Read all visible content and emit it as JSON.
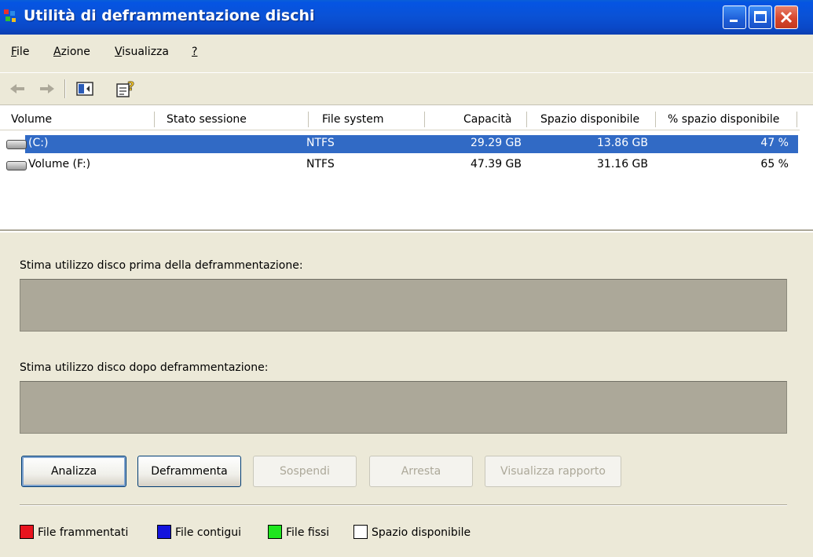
{
  "window": {
    "title": "Utilità di deframmentazione dischi"
  },
  "menu": [
    {
      "accel": "F",
      "rest": "ile"
    },
    {
      "accel": "A",
      "rest": "zione"
    },
    {
      "accel": "V",
      "rest": "isualizza"
    },
    {
      "accel": "?",
      "rest": ""
    }
  ],
  "toolbar": {
    "icons": [
      "back-arrow-icon",
      "forward-arrow-icon",
      "show-hide-console-tree-icon",
      "help-icon"
    ]
  },
  "table": {
    "headers": [
      "Volume",
      "Stato sessione",
      "File system",
      "Capacità",
      "Spazio disponibile",
      "% spazio disponibile"
    ],
    "rows": [
      {
        "volume": "(C:)",
        "status": "",
        "fs": "NTFS",
        "capacity": "29.29 GB",
        "free": "13.86 GB",
        "pct": "47 %",
        "selected": true
      },
      {
        "volume": "Volume (F:)",
        "status": "",
        "fs": "NTFS",
        "capacity": "47.39 GB",
        "free": "31.16 GB",
        "pct": "65 %",
        "selected": false
      }
    ]
  },
  "panel": {
    "before_label": "Stima utilizzo disco prima della deframmentazione:",
    "after_label": "Stima utilizzo disco dopo deframmentazione:"
  },
  "buttons": {
    "analyze": "Analizza",
    "defrag": "Deframmenta",
    "pause": "Sospendi",
    "stop": "Arresta",
    "report": "Visualizza rapporto"
  },
  "legend": [
    {
      "label": "File frammentati",
      "color": "#e8141e"
    },
    {
      "label": "File contigui",
      "color": "#1414dc"
    },
    {
      "label": "File fissi",
      "color": "#1ee61e"
    },
    {
      "label": "Spazio disponibile",
      "color": "#ffffff"
    }
  ],
  "colors": {
    "title_bar": "#0a52d6",
    "selection": "#316ac5",
    "bar_fill": "#aca899",
    "panel_bg": "#ece9d8"
  }
}
